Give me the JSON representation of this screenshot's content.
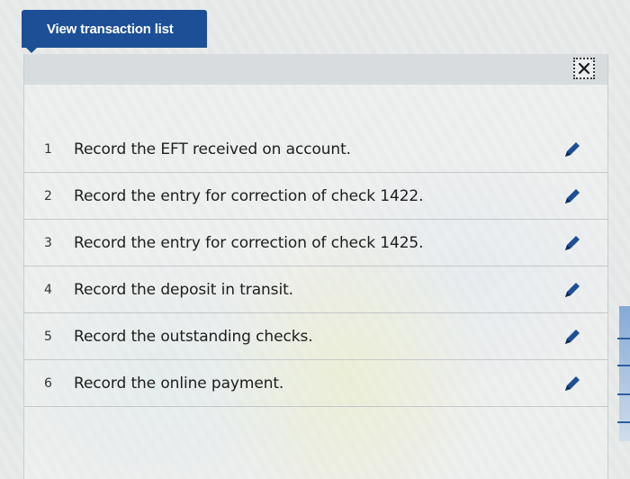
{
  "header": {
    "view_button_label": "View transaction list"
  },
  "panel": {
    "close_icon": "close-icon"
  },
  "transactions": [
    {
      "num": "1",
      "text": "Record the EFT received on account.",
      "icon": "pencil-icon"
    },
    {
      "num": "2",
      "text": "Record the entry for correction of check 1422.",
      "icon": "pencil-icon"
    },
    {
      "num": "3",
      "text": "Record the entry for correction of check 1425.",
      "icon": "pencil-icon"
    },
    {
      "num": "4",
      "text": "Record the deposit in transit.",
      "icon": "pencil-icon"
    },
    {
      "num": "5",
      "text": "Record the outstanding checks.",
      "icon": "pencil-icon"
    },
    {
      "num": "6",
      "text": "Record the online payment.",
      "icon": "pencil-icon"
    }
  ],
  "colors": {
    "brand": "#1c4f95",
    "edit_icon": "#1d4f96"
  }
}
